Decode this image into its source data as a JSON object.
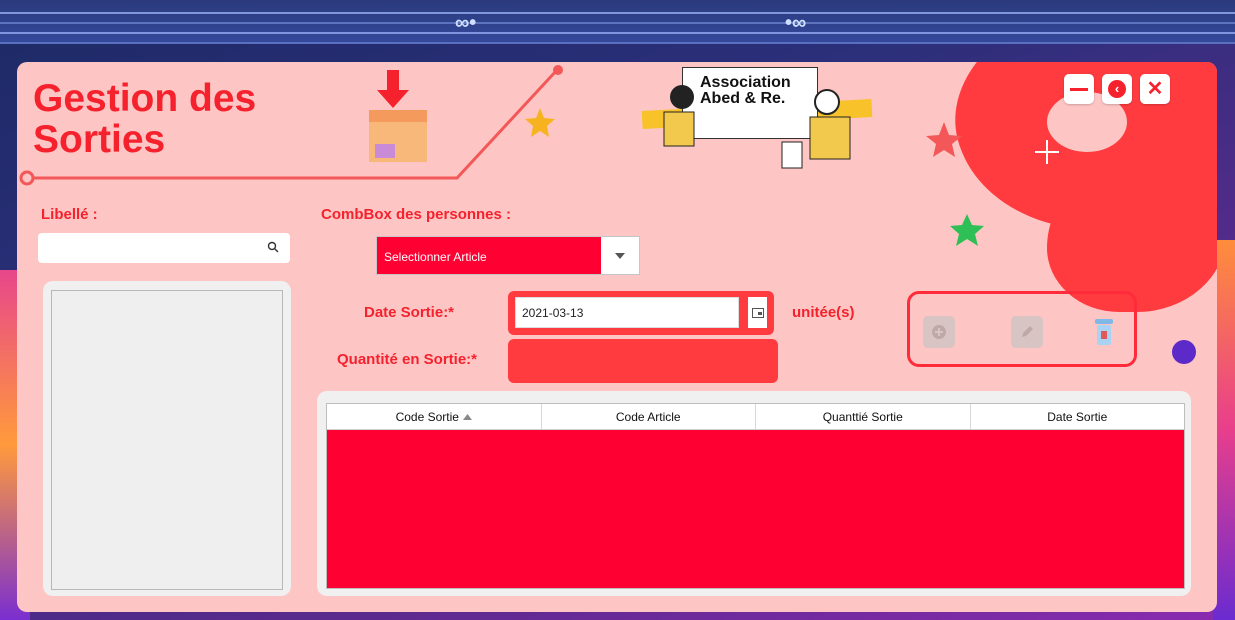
{
  "window": {
    "title_line1": "Gestion des",
    "title_line2": "Sorties",
    "logo_text": "Association Abed & Re."
  },
  "controls": {
    "minimize_icon": "minus-icon",
    "back_icon": "back-icon",
    "close_icon": "close-icon"
  },
  "left": {
    "libelle_label": "Libellé :",
    "search_value": "",
    "search_icon": "search-icon"
  },
  "form": {
    "combobox_label": "CombBox des personnes :",
    "combobox_value": "Selectionner Article",
    "date_label": "Date Sortie:*",
    "date_value": "2021-03-13",
    "quantity_label": "Quantité en Sortie:*",
    "quantity_value": "",
    "unit_label": "unitée(s)"
  },
  "actions": {
    "add_icon": "add-icon",
    "edit_icon": "edit-icon",
    "delete_icon": "trash-icon"
  },
  "table": {
    "columns": [
      "Code Sortie",
      "Code Article",
      "Quanttié Sortie",
      "Date Sortie"
    ],
    "sort_column": "Code Sortie",
    "rows": []
  },
  "colors": {
    "accent": "#f5222d",
    "background": "#fdc6c5",
    "field_red": "#ff3b3f",
    "table_body": "#ff0033"
  }
}
